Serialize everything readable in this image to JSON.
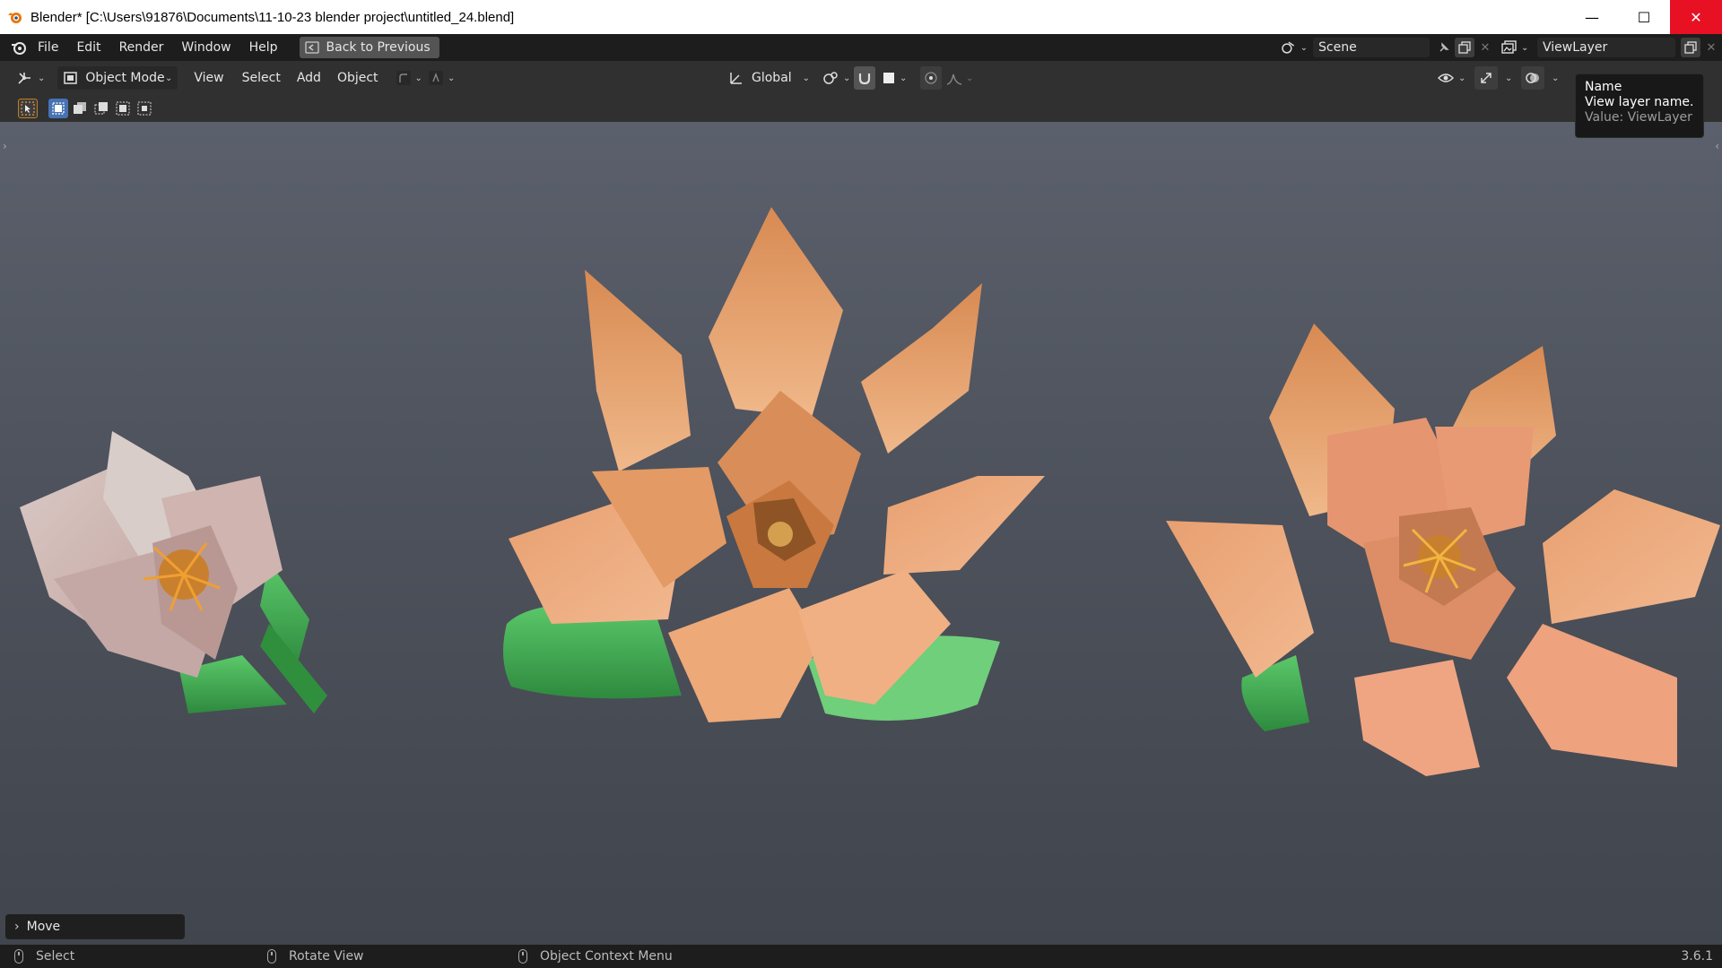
{
  "window": {
    "title": "Blender* [C:\\Users\\91876\\Documents\\11-10-23 blender project\\untitled_24.blend]",
    "minimize_glyph": "—",
    "maximize_glyph": "☐",
    "close_glyph": "✕"
  },
  "menubar": {
    "items": [
      "File",
      "Edit",
      "Render",
      "Window",
      "Help"
    ],
    "back_button": "Back to Previous",
    "scene_name": "Scene",
    "view_layer_name": "ViewLayer"
  },
  "header": {
    "mode": "Object Mode",
    "menus": [
      "View",
      "Select",
      "Add",
      "Object"
    ],
    "transform_orientation": "Global"
  },
  "tooltip": {
    "heading": "Name",
    "description": "View layer name.",
    "value": "Value: ViewLayer"
  },
  "operator_panel": {
    "label": "Move",
    "chevron": "›"
  },
  "statusbar": {
    "left_action": "Select",
    "middle_action": "Rotate View",
    "right_action": "Object Context Menu",
    "version": "3.6.1"
  },
  "colors": {
    "accent": "#4772b3",
    "close_red": "#e81123",
    "petal_orange": "#e8a070",
    "leaf_green": "#4cb050"
  }
}
